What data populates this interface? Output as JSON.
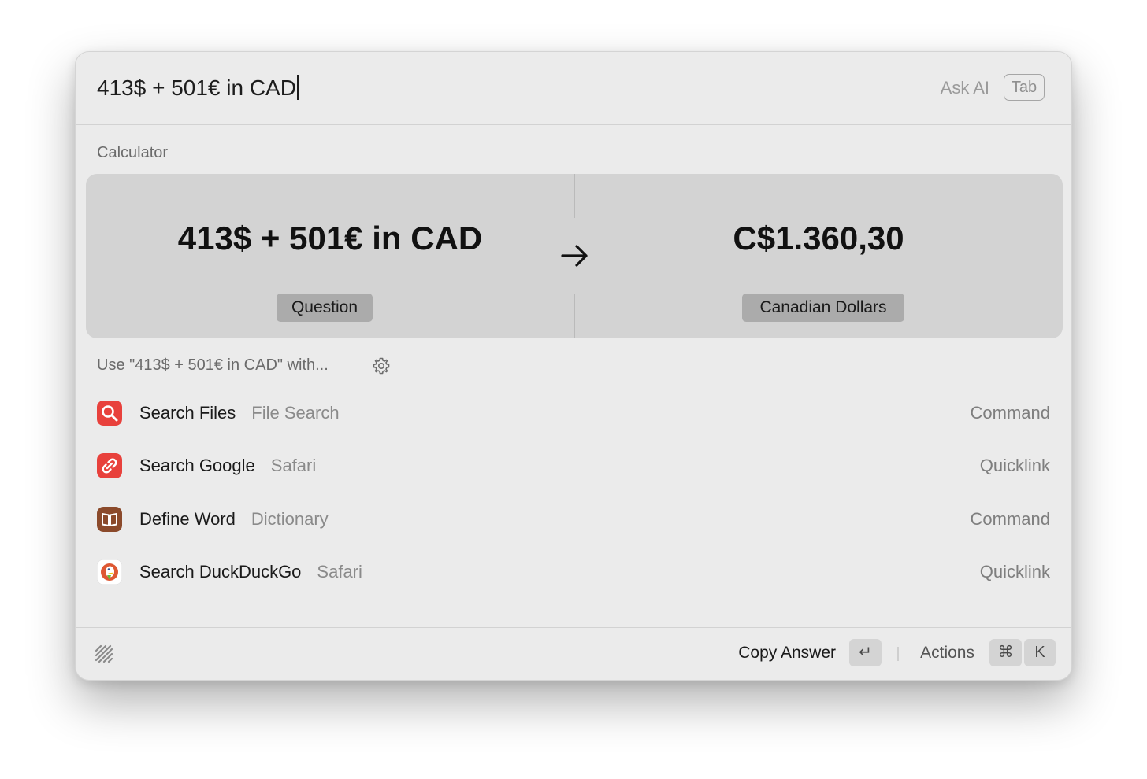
{
  "search": {
    "query": "413$ + 501€ in CAD",
    "ask_ai_label": "Ask AI",
    "tab_key": "Tab"
  },
  "calculator": {
    "section_label": "Calculator",
    "question": "413$ + 501€ in CAD",
    "question_label": "Question",
    "answer": "C$1.360,30",
    "answer_label": "Canadian Dollars"
  },
  "fallback": {
    "section_label": "Use \"413$ + 501€ in CAD\" with...",
    "items": [
      {
        "title": "Search Files",
        "subtitle": "File Search",
        "kind": "Command",
        "icon": "magnifier-icon",
        "color": "#e8413c"
      },
      {
        "title": "Search Google",
        "subtitle": "Safari",
        "kind": "Quicklink",
        "icon": "link-icon",
        "color": "#e8413c"
      },
      {
        "title": "Define Word",
        "subtitle": "Dictionary",
        "kind": "Command",
        "icon": "book-icon",
        "color": "#8b4a2b"
      },
      {
        "title": "Search DuckDuckGo",
        "subtitle": "Safari",
        "kind": "Quicklink",
        "icon": "duckduckgo-icon",
        "color": "#de5833"
      }
    ]
  },
  "footer": {
    "primary_action": "Copy Answer",
    "enter_key": "↵",
    "actions_label": "Actions",
    "cmd_key": "⌘",
    "k_key": "K"
  }
}
